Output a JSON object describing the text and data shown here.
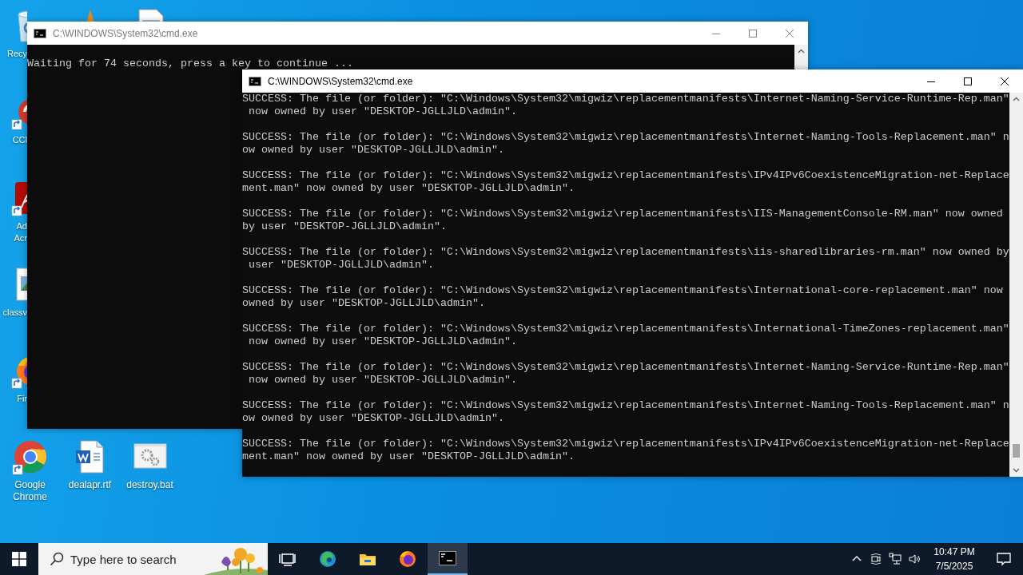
{
  "desktop": {
    "icons": [
      {
        "kind": "recycle-bin",
        "label": "Recy"
      },
      {
        "kind": "vlc"
      },
      {
        "kind": "document"
      },
      {
        "kind": "ccleaner",
        "label": "CCl"
      },
      {
        "kind": "acrobat",
        "label": "Ad Acr"
      },
      {
        "kind": "image-file",
        "label": "classv"
      },
      {
        "kind": "firefox",
        "label": "Fir"
      },
      {
        "kind": "chrome",
        "label": "Google Chrome"
      },
      {
        "kind": "word-doc",
        "label": "dealapr.rtf"
      },
      {
        "kind": "batch-file",
        "label": "destroy.bat"
      }
    ]
  },
  "windows": [
    {
      "title": "C:\\WINDOWS\\System32\\cmd.exe",
      "active": false,
      "entries": [
        [
          "Waiting for 74 seconds, press a key to continue ..."
        ]
      ]
    },
    {
      "title": "C:\\WINDOWS\\System32\\cmd.exe",
      "active": true,
      "entries": [
        [
          "SUCCESS: The file (or folder): \"C:\\Windows\\System32\\migwiz\\replacementmanifests\\Internet-Naming-Service-Runtime-Rep.man\"",
          " now owned by user \"DESKTOP-JGLLJLD\\admin\"."
        ],
        [
          "SUCCESS: The file (or folder): \"C:\\Windows\\System32\\migwiz\\replacementmanifests\\Internet-Naming-Tools-Replacement.man\" n",
          "ow owned by user \"DESKTOP-JGLLJLD\\admin\"."
        ],
        [
          "SUCCESS: The file (or folder): \"C:\\Windows\\System32\\migwiz\\replacementmanifests\\IPv4IPv6CoexistenceMigration-net-Replace",
          "ment.man\" now owned by user \"DESKTOP-JGLLJLD\\admin\"."
        ],
        [
          "SUCCESS: The file (or folder): \"C:\\Windows\\System32\\migwiz\\replacementmanifests\\IIS-ManagementConsole-RM.man\" now owned",
          "by user \"DESKTOP-JGLLJLD\\admin\"."
        ],
        [
          "SUCCESS: The file (or folder): \"C:\\Windows\\System32\\migwiz\\replacementmanifests\\iis-sharedlibraries-rm.man\" now owned by",
          " user \"DESKTOP-JGLLJLD\\admin\"."
        ],
        [
          "SUCCESS: The file (or folder): \"C:\\Windows\\System32\\migwiz\\replacementmanifests\\International-core-replacement.man\" now",
          "owned by user \"DESKTOP-JGLLJLD\\admin\"."
        ],
        [
          "SUCCESS: The file (or folder): \"C:\\Windows\\System32\\migwiz\\replacementmanifests\\International-TimeZones-replacement.man\"",
          " now owned by user \"DESKTOP-JGLLJLD\\admin\"."
        ],
        [
          "SUCCESS: The file (or folder): \"C:\\Windows\\System32\\migwiz\\replacementmanifests\\Internet-Naming-Service-Runtime-Rep.man\"",
          " now owned by user \"DESKTOP-JGLLJLD\\admin\"."
        ],
        [
          "SUCCESS: The file (or folder): \"C:\\Windows\\System32\\migwiz\\replacementmanifests\\Internet-Naming-Tools-Replacement.man\" n",
          "ow owned by user \"DESKTOP-JGLLJLD\\admin\"."
        ],
        [
          "SUCCESS: The file (or folder): \"C:\\Windows\\System32\\migwiz\\replacementmanifests\\IPv4IPv6CoexistenceMigration-net-Replace",
          "ment.man\" now owned by user \"DESKTOP-JGLLJLD\\admin\"."
        ]
      ]
    }
  ],
  "taskbar": {
    "search": {
      "placeholder": "Type here to search"
    },
    "apps": [
      {
        "kind": "task-view",
        "active": false
      },
      {
        "kind": "edge",
        "active": false
      },
      {
        "kind": "explorer",
        "active": false
      },
      {
        "kind": "firefox",
        "active": false
      },
      {
        "kind": "terminal",
        "active": true
      }
    ],
    "clock": {
      "time": "10:47 PM",
      "date": "7/5/2025"
    }
  }
}
